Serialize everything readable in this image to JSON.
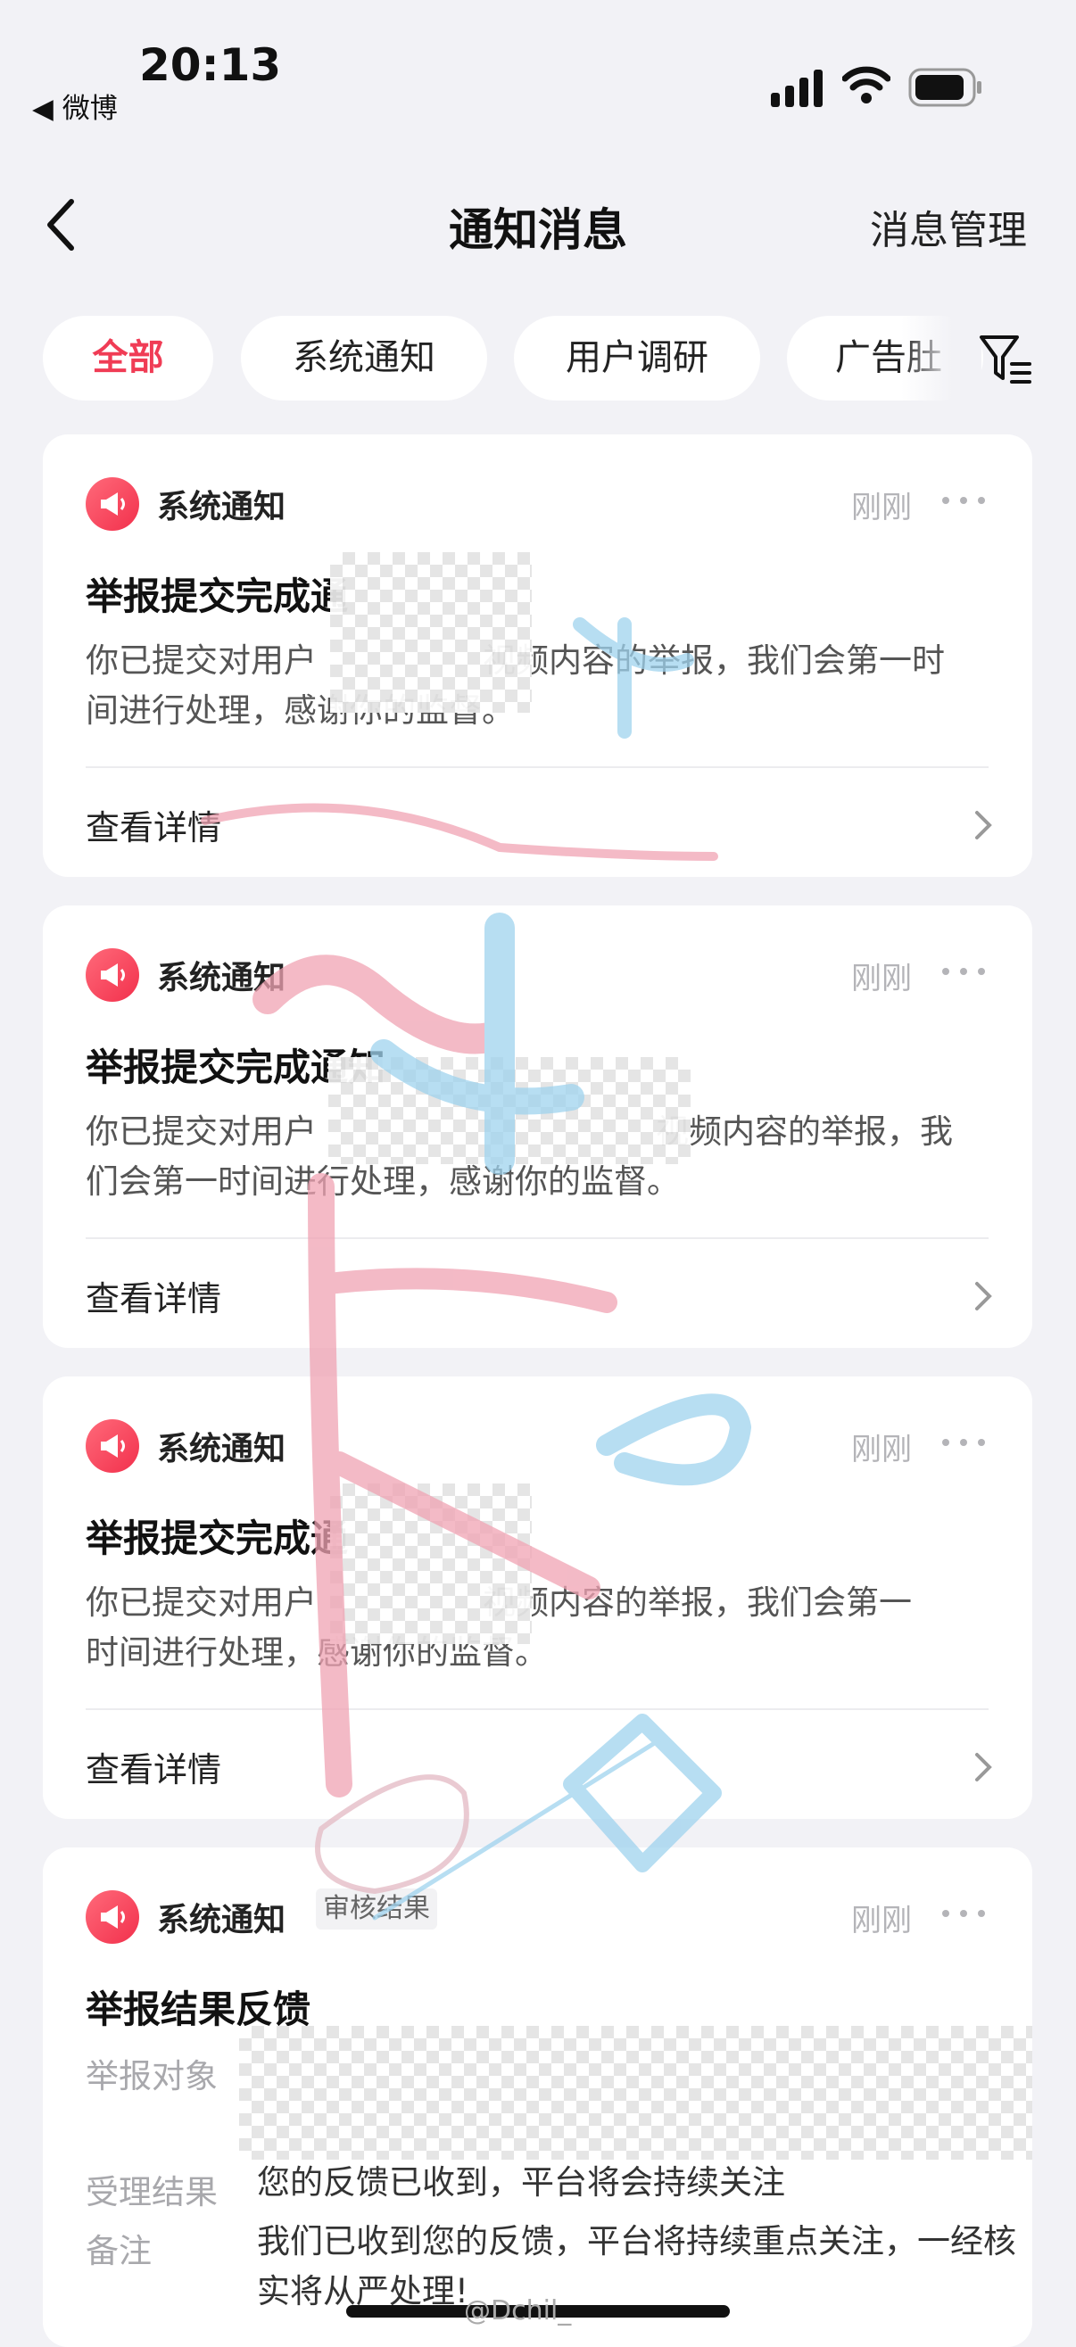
{
  "status_bar": {
    "time": "20:13",
    "back_app": "◀ 微博"
  },
  "nav": {
    "title": "通知消息",
    "manage": "消息管理",
    "back_icon": "chevron-left-icon"
  },
  "tabs": [
    {
      "label": "全部",
      "active": true
    },
    {
      "label": "系统通知"
    },
    {
      "label": "用户调研"
    },
    {
      "label": "广告肚"
    }
  ],
  "colors": {
    "accent": "#f03c55",
    "background": "#f2f2f6",
    "card": "#ffffff"
  },
  "cards": [
    {
      "source": "系统通知",
      "time": "刚刚",
      "title": "举报提交完成通",
      "body_1": "你已提交对用户",
      "body_2": "视频内容的举报，我们会第一时",
      "body_3": "间进行处理，感谢你的监督。",
      "link": "查看详情"
    },
    {
      "source": "系统通知",
      "time": "刚刚",
      "title": "举报提交完成通知",
      "body_1": "你已提交对用户",
      "body_2": "视频内容的举报，我",
      "body_3": "们会第一时间进行处理，感谢你的监督。",
      "link": "查看详情"
    },
    {
      "source": "系统通知",
      "time": "刚刚",
      "title": "举报提交完成通",
      "body_1": "你已提交对用户",
      "body_2": "视频内容的举报，我们会第一",
      "body_3": "时间进行处理，感谢你的监督。",
      "link": "查看详情"
    },
    {
      "source": "系统通知",
      "tag": "审核结果",
      "time": "刚刚",
      "title": "举报结果反馈",
      "target_label": "举报对象",
      "result_label": "受理结果",
      "result_value": "您的反馈已收到，平台将会持续关注",
      "note_label": "备注",
      "note_value": "我们已收到您的反馈，平台将持续重点关注，一经核实将从严处理!"
    }
  ],
  "watermark": {
    "text": "@Dchil_"
  }
}
